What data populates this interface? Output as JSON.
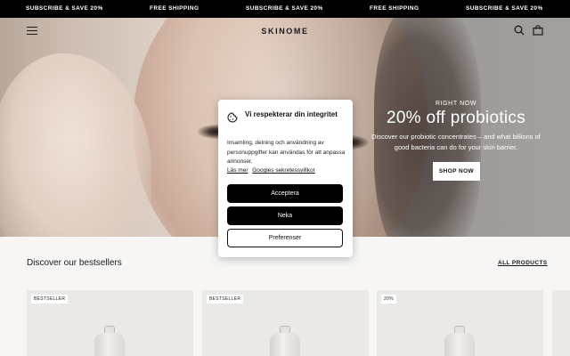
{
  "ticker": {
    "items": [
      "SUBSCRIBE & SAVE 20%",
      "FREE SHIPPING",
      "SUBSCRIBE & SAVE 20%",
      "FREE SHIPPING",
      "SUBSCRIBE & SAVE 20%"
    ]
  },
  "header": {
    "logo": "SKINOME",
    "menu_icon": "hamburger-icon",
    "search_icon": "search-icon",
    "cart_icon": "shopping-bag-icon"
  },
  "hero": {
    "eyebrow": "RIGHT NOW",
    "title": "20% off probiotics",
    "description": "Discover our probiotic concentrates – and what billions of good bacteria can do for your skin barrier.",
    "cta": "SHOP NOW"
  },
  "bestsellers": {
    "title": "Discover our bestsellers",
    "all_link": "ALL PRODUCTS",
    "cards": [
      {
        "badge": "BESTSELLER"
      },
      {
        "badge": "BESTSELLER"
      },
      {
        "badge": "20%"
      }
    ]
  },
  "cookie": {
    "title": "Vi respekterar din integritet",
    "text": "Insamling, delning och användning av personuppgifter kan användas för att anpassa annonser.",
    "link_more": "Läs mer",
    "link_terms": "Googles sekretessvillkor",
    "accept": "Acceptera",
    "deny": "Neka",
    "preferences": "Preferenser"
  },
  "colors": {
    "ticker_bg": "#000000",
    "page_bg": "#f7f6f4",
    "card_bg": "#ebe9e6",
    "button_dark": "#000000"
  }
}
